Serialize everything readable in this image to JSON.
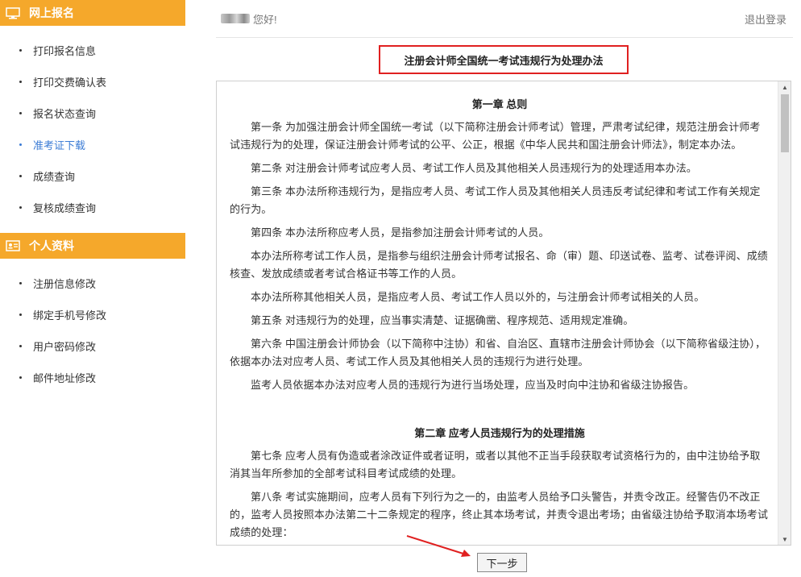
{
  "sidebar": {
    "groups": [
      {
        "title": "网上报名",
        "icon": "monitor-icon",
        "items": [
          {
            "label": "打印报名信息",
            "active": false
          },
          {
            "label": "打印交费确认表",
            "active": false
          },
          {
            "label": "报名状态查询",
            "active": false
          },
          {
            "label": "准考证下载",
            "active": true
          },
          {
            "label": "成绩查询",
            "active": false
          },
          {
            "label": "复核成绩查询",
            "active": false
          }
        ]
      },
      {
        "title": "个人资料",
        "icon": "id-card-icon",
        "items": [
          {
            "label": "注册信息修改",
            "active": false
          },
          {
            "label": "绑定手机号修改",
            "active": false
          },
          {
            "label": "用户密码修改",
            "active": false
          },
          {
            "label": "邮件地址修改",
            "active": false
          }
        ]
      }
    ]
  },
  "header": {
    "greeting": "您好!",
    "logout": "退出登录"
  },
  "document": {
    "title": "注册会计师全国统一考试违规行为处理办法",
    "chapter1": "第一章 总则",
    "paras1": [
      "第一条 为加强注册会计师全国统一考试（以下简称注册会计师考试）管理，严肃考试纪律，规范注册会计师考试违规行为的处理，保证注册会计师考试的公平、公正，根据《中华人民共和国注册会计师法》，制定本办法。",
      "第二条 对注册会计师考试应考人员、考试工作人员及其他相关人员违规行为的处理适用本办法。",
      "第三条 本办法所称违规行为，是指应考人员、考试工作人员及其他相关人员违反考试纪律和考试工作有关规定的行为。",
      "第四条 本办法所称应考人员，是指参加注册会计师考试的人员。",
      "本办法所称考试工作人员，是指参与组织注册会计师考试报名、命（审）题、印送试卷、监考、试卷评阅、成绩核查、发放成绩或者考试合格证书等工作的人员。",
      "本办法所称其他相关人员，是指应考人员、考试工作人员以外的，与注册会计师考试相关的人员。",
      "第五条 对违规行为的处理，应当事实清楚、证据确凿、程序规范、适用规定准确。",
      "第六条 中国注册会计师协会（以下简称中注协）和省、自治区、直辖市注册会计师协会（以下简称省级注协），依据本办法对应考人员、考试工作人员及其他相关人员的违规行为进行处理。",
      "监考人员依据本办法对应考人员的违规行为进行当场处理，应当及时向中注协和省级注协报告。"
    ],
    "chapter2": "第二章 应考人员违规行为的处理措施",
    "paras2": [
      "第七条 应考人员有伪造或者涂改证件或者证明，或者以其他不正当手段获取考试资格行为的，由中注协给予取消其当年所参加的全部考试科目考试成绩的处理。",
      "第八条 考试实施期间，应考人员有下列行为之一的，由监考人员给予口头警告，并责令改正。经警告仍不改正的，监考人员按照本办法第二十二条规定的程序，终止其本场考试，并责令退出考场；由省级注协给予取消本场考试成绩的处理："
    ]
  },
  "footer": {
    "next_label": "下一步"
  },
  "colors": {
    "sidebar_header": "#f5a82b",
    "active_item": "#3a7bd5",
    "highlight_border": "#e02020"
  }
}
